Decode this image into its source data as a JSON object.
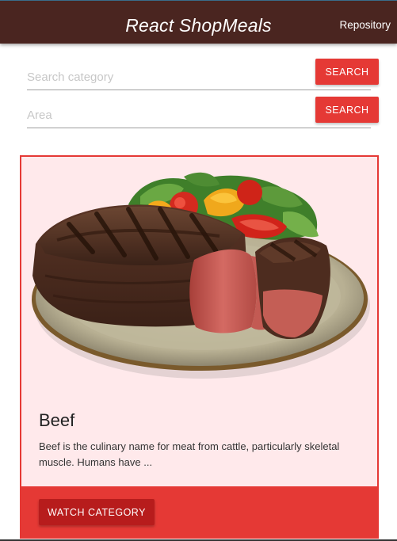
{
  "header": {
    "title": "React ShopMeals",
    "repository_link": "Repository"
  },
  "search": {
    "category": {
      "placeholder": "Search category",
      "value": "",
      "button_label": "SEARCH"
    },
    "area": {
      "placeholder": "Area",
      "value": "",
      "button_label": "SEARCH"
    }
  },
  "card": {
    "image_alt": "grilled-steak-with-salad-image",
    "title": "Beef",
    "description": "Beef is the culinary name for meat from cattle, particularly skeletal muscle. Humans have ...",
    "action_label": "WATCH CATEGORY"
  },
  "colors": {
    "header_bg": "#4a2520",
    "accent": "#e53935",
    "accent_dark": "#b71c1c",
    "card_bg": "#ffe9eb"
  }
}
